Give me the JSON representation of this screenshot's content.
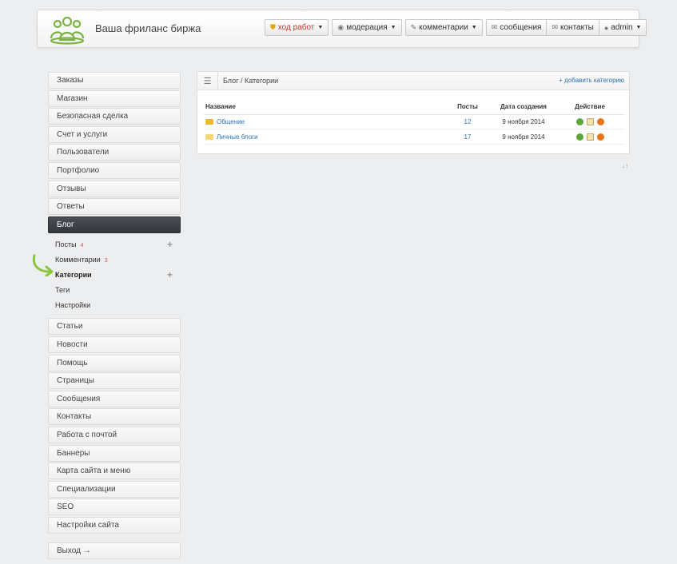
{
  "header": {
    "brand": "Ваша фриланс биржа",
    "buttons": {
      "progress": "ход работ",
      "moderation": "модерация",
      "comments": "комментарии",
      "messages": "сообщения",
      "contacts": "контакты",
      "user": "admin"
    }
  },
  "sidebar": {
    "items_top": [
      "Заказы",
      "Магазин",
      "Безопасная сделка",
      "Счет и услуги",
      "Пользователи",
      "Портфолио",
      "Отзывы",
      "Ответы"
    ],
    "active": "Блог",
    "subnav": {
      "posts": "Посты",
      "posts_count": "4",
      "comments": "Комментарии",
      "comments_count": "3",
      "categories": "Категории",
      "tags": "Теги",
      "settings": "Настройки"
    },
    "items_bottom": [
      "Статьи",
      "Новости",
      "Помощь",
      "Страницы",
      "Сообщения",
      "Контакты",
      "Работа с почтой",
      "Баннеры",
      "Карта сайта и меню",
      "Специализации",
      "SEO",
      "Настройки сайта"
    ],
    "logout": "Выход →"
  },
  "main": {
    "breadcrumb": "Блог / Категории",
    "add_link": "+ добавить категорию",
    "columns": {
      "name": "Название",
      "posts": "Посты",
      "date": "Дата создания",
      "action": "Действие"
    },
    "rows": [
      {
        "name": "Общение",
        "posts": "12",
        "date": "9 ноября 2014"
      },
      {
        "name": "Личные блоги",
        "posts": "17",
        "date": "9 ноября 2014"
      }
    ],
    "sort_icon": "↓↑"
  },
  "colors": {
    "accent": "#2a72b5",
    "active_bg": "#3a3d42",
    "badge": "#d9534f",
    "logo": "#7cb342"
  }
}
